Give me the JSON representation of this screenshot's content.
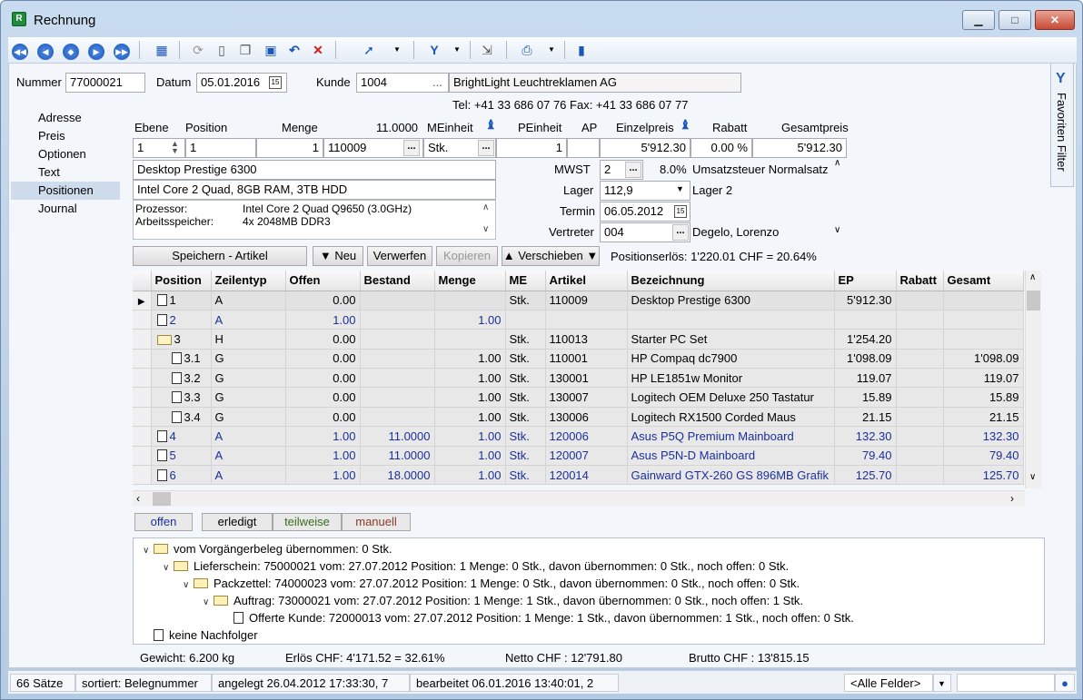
{
  "window": {
    "title": "Rechnung",
    "app_icon": "R"
  },
  "toolbar": {
    "icons": [
      "first-record-icon",
      "previous-record-icon",
      "previous-page-icon",
      "next-record-icon",
      "last-record-icon",
      "table-view-icon",
      "refresh-icon",
      "new-document-icon",
      "copy-document-icon",
      "save-icon",
      "undo-icon",
      "delete-icon",
      "filter-cursor-icon",
      "filter-icon",
      "export-icon",
      "print-icon",
      "book-icon"
    ]
  },
  "header": {
    "nummer_label": "Nummer",
    "nummer_value": "77000021",
    "datum_label": "Datum",
    "datum_value": "05.01.2016",
    "kunde_label": "Kunde",
    "kunde_value": "1004",
    "kunde_dots": "...",
    "kunde_name": "BrightLight Leuchtreklamen AG",
    "phone_line": "Tel: +41 33 686 07 76   Fax: +41 33 686 07 77"
  },
  "sidebar": {
    "items": [
      {
        "label": "Adresse"
      },
      {
        "label": "Preis"
      },
      {
        "label": "Optionen"
      },
      {
        "label": "Text"
      },
      {
        "label": "Positionen"
      },
      {
        "label": "Journal"
      }
    ]
  },
  "favorites": {
    "label": "Favoriten Filter"
  },
  "position_editor": {
    "col_ebene": "Ebene",
    "col_position": "Position",
    "col_menge": "Menge",
    "menge_total": "11.0000",
    "col_meinheit": "MEinheit",
    "col_peinheit": "PEinheit",
    "col_ap": "AP",
    "col_einzelpreis": "Einzelpreis",
    "col_rabatt": "Rabatt",
    "col_gesamtpreis": "Gesamtpreis",
    "ebene": "1",
    "position": "1",
    "menge": "1",
    "artikel": "110009",
    "dots": "...",
    "meinheit": "Stk.",
    "peinheit": "1",
    "einzelpreis": "5'912.30",
    "rabatt": "0.00 %",
    "gesamtpreis": "5'912.30",
    "bezeichnung": "Desktop Prestige 6300",
    "beschreibung": "Intel Core 2 Quad, 8GB RAM, 3TB HDD",
    "spec_label_1": "Prozessor:",
    "spec_value_1": "Intel Core 2 Quad Q9650 (3.0GHz)",
    "spec_label_2": "Arbeitsspeicher:",
    "spec_value_2": "4x 2048MB DDR3",
    "mwst_label": "MWST",
    "mwst_code": "2",
    "mwst_rate": "8.0%",
    "mwst_text": "Umsatzsteuer Normalsatz",
    "lager_label": "Lager",
    "lager_value": "112,9",
    "lager_text": "Lager 2",
    "termin_label": "Termin",
    "termin_value": "06.05.2012",
    "vertreter_label": "Vertreter",
    "vertreter_value": "004",
    "vertreter_text": "Degelo, Lorenzo"
  },
  "actions": {
    "save": "Speichern - Artikel",
    "new": "Neu",
    "discard": "Verwerfen",
    "copy": "Kopieren",
    "move": "Verschieben",
    "erloes": "Positionserlös:  1'220.01 CHF = 20.64%"
  },
  "grid": {
    "columns": [
      "Position",
      "Zeilentyp",
      "Offen",
      "Bestand",
      "Menge",
      "ME",
      "Artikel",
      "Bezeichnung",
      "EP",
      "Rabatt",
      "Gesamt"
    ],
    "rows": [
      {
        "pos": "1",
        "icon": "doc",
        "indent": 0,
        "typ": "A",
        "offen": "0.00",
        "bestand": "",
        "menge": "",
        "me": "Stk.",
        "artikel": "110009",
        "bez": "Desktop Prestige 6300",
        "ep": "5'912.30",
        "rabatt": "",
        "gesamt": "",
        "style": "g",
        "current": true
      },
      {
        "pos": "2",
        "icon": "doc",
        "indent": 0,
        "typ": "A",
        "offen": "1.00",
        "bestand": "",
        "menge": "1.00",
        "me": "",
        "artikel": "",
        "bez": "",
        "ep": "",
        "rabatt": "",
        "gesamt": "",
        "style": "g blue"
      },
      {
        "pos": "3",
        "icon": "folder",
        "indent": 0,
        "typ": "H",
        "offen": "0.00",
        "bestand": "",
        "menge": "",
        "me": "Stk.",
        "artikel": "110013",
        "bez": "Starter PC Set",
        "ep": "1'254.20",
        "rabatt": "",
        "gesamt": "",
        "style": "g"
      },
      {
        "pos": "3.1",
        "icon": "doc",
        "indent": 1,
        "typ": "G",
        "offen": "0.00",
        "bestand": "",
        "menge": "1.00",
        "me": "Stk.",
        "artikel": "110001",
        "bez": "HP Compaq dc7900",
        "ep": "1'098.09",
        "rabatt": "",
        "gesamt": "1'098.09",
        "style": "g"
      },
      {
        "pos": "3.2",
        "icon": "doc",
        "indent": 1,
        "typ": "G",
        "offen": "0.00",
        "bestand": "",
        "menge": "1.00",
        "me": "Stk.",
        "artikel": "130001",
        "bez": "HP LE1851w Monitor",
        "ep": "119.07",
        "rabatt": "",
        "gesamt": "119.07",
        "style": "g"
      },
      {
        "pos": "3.3",
        "icon": "doc",
        "indent": 1,
        "typ": "G",
        "offen": "0.00",
        "bestand": "",
        "menge": "1.00",
        "me": "Stk.",
        "artikel": "130007",
        "bez": "Logitech OEM Deluxe 250 Tastatur",
        "ep": "15.89",
        "rabatt": "",
        "gesamt": "15.89",
        "style": "g"
      },
      {
        "pos": "3.4",
        "icon": "doc",
        "indent": 1,
        "typ": "G",
        "offen": "0.00",
        "bestand": "",
        "menge": "1.00",
        "me": "Stk.",
        "artikel": "130006",
        "bez": "Logitech RX1500 Corded Maus",
        "ep": "21.15",
        "rabatt": "",
        "gesamt": "21.15",
        "style": "g"
      },
      {
        "pos": "4",
        "icon": "doc",
        "indent": 0,
        "typ": "A",
        "offen": "1.00",
        "bestand": "11.0000",
        "menge": "1.00",
        "me": "Stk.",
        "artikel": "120006",
        "bez": "Asus P5Q Premium Mainboard",
        "ep": "132.30",
        "rabatt": "",
        "gesamt": "132.30",
        "style": "g blue"
      },
      {
        "pos": "5",
        "icon": "doc",
        "indent": 0,
        "typ": "A",
        "offen": "1.00",
        "bestand": "11.0000",
        "menge": "1.00",
        "me": "Stk.",
        "artikel": "120007",
        "bez": "Asus P5N-D Mainboard",
        "ep": "79.40",
        "rabatt": "",
        "gesamt": "79.40",
        "style": "g blue"
      },
      {
        "pos": "6",
        "icon": "doc",
        "indent": 0,
        "typ": "A",
        "offen": "1.00",
        "bestand": "18.0000",
        "menge": "1.00",
        "me": "Stk.",
        "artikel": "120014",
        "bez": "Gainward GTX-260 GS 896MB Grafik",
        "ep": "125.70",
        "rabatt": "",
        "gesamt": "125.70",
        "style": "g blue"
      }
    ]
  },
  "status_tabs": {
    "offen": "offen",
    "erledigt": "erledigt",
    "teilweise": "teilweise",
    "manuell": "manuell"
  },
  "tree": {
    "nodes": [
      {
        "label": "vom Vorgängerbeleg übernommen: 0 Stk.",
        "level": 0,
        "icon": "folder",
        "expander": "∨"
      },
      {
        "label": "Lieferschein: 75000021 vom: 27.07.2012 Position: 1 Menge: 0 Stk., davon übernommen: 0 Stk., noch offen: 0 Stk.",
        "level": 1,
        "icon": "folder",
        "expander": "∨"
      },
      {
        "label": "Packzettel: 74000023 vom: 27.07.2012 Position: 1 Menge: 0 Stk., davon übernommen: 0 Stk., noch offen: 0 Stk.",
        "level": 2,
        "icon": "folder",
        "expander": "∨"
      },
      {
        "label": "Auftrag: 73000021 vom: 27.07.2012 Position: 1 Menge: 1 Stk., davon übernommen: 0 Stk., noch offen: 1 Stk.",
        "level": 3,
        "icon": "folder",
        "expander": "∨"
      },
      {
        "label": "Offerte Kunde: 72000013 vom: 27.07.2012 Position: 1 Menge: 1 Stk., davon übernommen: 1 Stk., noch offen: 0 Stk.",
        "level": 4,
        "icon": "doc",
        "expander": ""
      },
      {
        "label": "keine Nachfolger",
        "level": 0,
        "icon": "doc",
        "expander": ""
      }
    ]
  },
  "totals": {
    "gewicht": "Gewicht:  6.200 kg",
    "erloes": "Erlös CHF: 4'171.52 = 32.61%",
    "netto": "Netto CHF : 12'791.80",
    "brutto": "Brutto CHF : 13'815.15"
  },
  "statusbar": {
    "count": "66 Sätze",
    "sorted": "sortiert: Belegnummer",
    "created": "angelegt 26.04.2012 17:33:30,  7",
    "edited": "bearbeitet 06.01.2016 13:40:01,  2",
    "field_filter": "<Alle Felder>"
  }
}
